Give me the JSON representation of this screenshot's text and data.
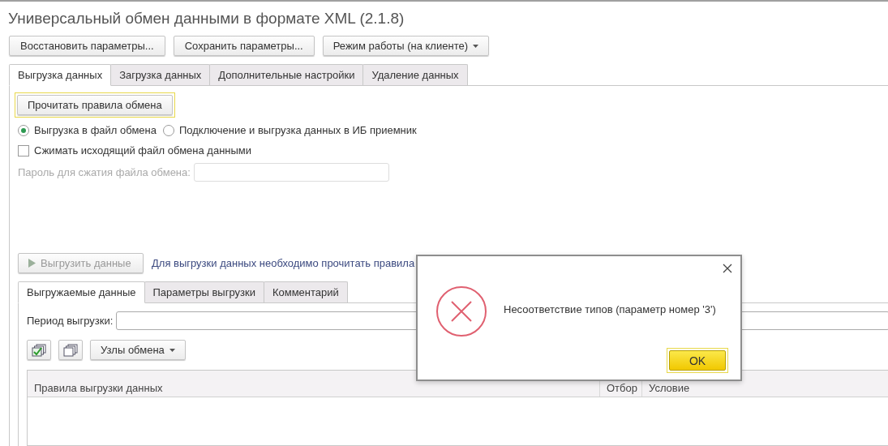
{
  "window": {
    "title": "Универсальный обмен данными в формате XML (2.1.8)"
  },
  "toolbar": [
    {
      "label": "Восстановить параметры...",
      "kind": "button"
    },
    {
      "label": "Сохранить параметры...",
      "kind": "button"
    },
    {
      "label": "Режим работы (на клиенте)",
      "kind": "dropdown"
    }
  ],
  "tabs": [
    {
      "label": "Выгрузка данных",
      "selected": true
    },
    {
      "label": "Загрузка данных",
      "selected": false
    },
    {
      "label": "Дополнительные настройки",
      "selected": false
    },
    {
      "label": "Удаление данных",
      "selected": false
    }
  ],
  "export_tab": {
    "read_rules_button": "Прочитать правила обмена",
    "modes": [
      {
        "label": "Выгрузка в файл обмена",
        "selected": true
      },
      {
        "label": "Подключение и выгрузка данных в ИБ приемник",
        "selected": false
      }
    ],
    "compress": {
      "label": "Сжимать исходящий файл обмена данными",
      "checked": false
    },
    "password": {
      "label": "Пароль для сжатия файла обмена:",
      "disabled": true
    },
    "export_button": {
      "label": "Выгрузить данные",
      "disabled": true
    },
    "hint": "Для выгрузки данных необходимо прочитать правила"
  },
  "inner_tabs": [
    {
      "label": "Выгружаемые данные",
      "selected": true
    },
    {
      "label": "Параметры выгрузки",
      "selected": false
    },
    {
      "label": "Комментарий",
      "selected": false
    }
  ],
  "period": {
    "label": "Период выгрузки:"
  },
  "nodes_button": "Узлы обмена",
  "table": {
    "columns": [
      "Правила выгрузки данных",
      "Отбор",
      "Условие"
    ]
  },
  "dialog": {
    "message": "Несоответствие типов (параметр номер '3')",
    "button": "OK"
  }
}
